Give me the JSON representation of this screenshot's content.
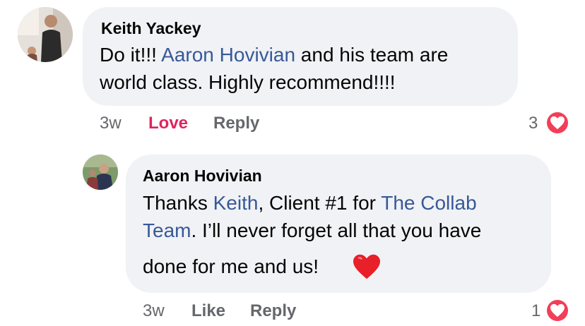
{
  "comments": [
    {
      "author": "Keith Yackey",
      "text_parts": [
        "Do it!!! ",
        "Aaron Hovivian",
        " and his team are",
        "world class. Highly recommend!!!!"
      ],
      "time": "3w",
      "reaction_label": "Love",
      "reply_label": "Reply",
      "reaction_count": "3",
      "avatar_icon": "profile-photo",
      "reaction_icon": "heart-icon"
    },
    {
      "author": "Aaron Hovivian",
      "text_parts": [
        "Thanks ",
        "Keith",
        ", Client #1 for ",
        "The Collab",
        "Team",
        ". I’ll never forget all that you have",
        "done for me and us!"
      ],
      "emoji": "red-heart-emoji",
      "time": "3w",
      "reaction_label": "Like",
      "reply_label": "Reply",
      "reaction_count": "1",
      "avatar_icon": "profile-photo",
      "reaction_icon": "heart-icon"
    }
  ],
  "colors": {
    "bubble": "#f0f2f5",
    "mention": "#385898",
    "meta": "#65676b",
    "love": "#e0245e",
    "heart": "#f33e58"
  }
}
